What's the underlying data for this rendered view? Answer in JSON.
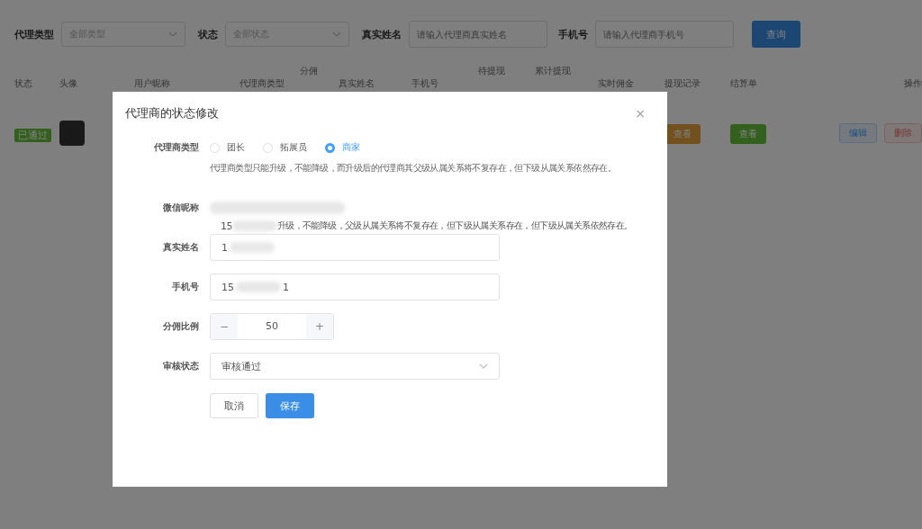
{
  "filters": [
    {
      "label": "代理类型",
      "kind": "select",
      "placeholder": "全部类型"
    },
    {
      "label": "状态",
      "kind": "select",
      "placeholder": "全部状态"
    },
    {
      "label": "真实姓名",
      "kind": "input",
      "placeholder": "请输入代理商真实姓名"
    },
    {
      "label": "手机号",
      "kind": "input",
      "placeholder": "请输入代理商手机号"
    }
  ],
  "search_button": "查询",
  "table": {
    "columns": [
      "状态",
      "头像",
      "用户昵称",
      "代理商类型",
      "分佣",
      "真实姓名",
      "手机号",
      "待提现",
      "累计提现",
      "实时佣金",
      "提现记录",
      "结算单",
      "操作"
    ],
    "rows": [
      {
        "status": "已通过",
        "withdraw_button": "查看",
        "statement_button": "查看",
        "edit_button": "编辑",
        "delete_button": "删除"
      }
    ]
  },
  "dialog": {
    "title": "代理商的状态修改",
    "close": "×",
    "type_label": "代理商类型",
    "types": [
      {
        "label": "团长",
        "selected": false
      },
      {
        "label": "拓展员",
        "selected": false
      },
      {
        "label": "商家",
        "selected": true
      }
    ],
    "type_hint": "代理商类型只能升级，不能降级，而升级后的代理商其父级从属关系将不复存在，但下级从属关系依然存在。",
    "nickname_label": "微信昵称",
    "overlay_prefix": "15",
    "overlay_text": "升级，不能降级，父级从属关系将不复存在，但下级从属关系存在，但下级从属关系依然存在。",
    "realname_label": "真实姓名",
    "realname_value": "1",
    "phone_label": "手机号",
    "phone_prefix": "15",
    "phone_suffix": "1",
    "ratio_label": "分佣比例",
    "ratio_minus": "−",
    "ratio_value": "50",
    "ratio_plus": "+",
    "review_label": "审核状态",
    "review_value": "审核通过",
    "cancel": "取消",
    "save": "保存"
  }
}
